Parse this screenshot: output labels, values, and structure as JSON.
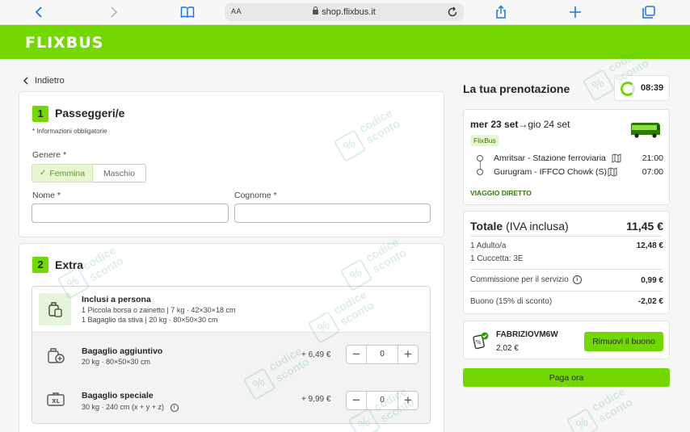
{
  "browser": {
    "aa_label": "AA",
    "url": "shop.flixbus.it"
  },
  "brand": {
    "logo": "FLIXBUS",
    "accent": "#73d700"
  },
  "nav": {
    "back_label": "Indietro"
  },
  "passengers": {
    "step": "1",
    "title": "Passeggeri/e",
    "required_note": "* Informazioni obbligatorie",
    "gender_label": "Genere *",
    "gender_options": [
      "Femmina",
      "Maschio"
    ],
    "gender_selected": "Femmina",
    "first_name_label": "Nome *",
    "last_name_label": "Cognome *",
    "first_name_value": "",
    "last_name_value": ""
  },
  "extras": {
    "step": "2",
    "title": "Extra",
    "included": {
      "title": "Inclusi a persona",
      "line1": "1 Piccola borsa o zainetto | 7 kg · 42×30×18 cm",
      "line2": "1 Bagaglio da stiva | 20 kg · 80×50×30 cm"
    },
    "items": [
      {
        "title": "Bagaglio aggiuntivo",
        "desc": "20 kg · 80×50×30 cm",
        "price": "+ 6,49 €",
        "qty": "0",
        "icon": "luggage-plus-icon"
      },
      {
        "title": "Bagaglio speciale",
        "desc": "30 kg · 240 cm (x + y + z)",
        "price": "+ 9,99 €",
        "qty": "0",
        "icon": "xl-luggage-icon"
      }
    ]
  },
  "booking": {
    "title": "La tua prenotazione",
    "timer": "08:39",
    "date_bold": "mer 23 set",
    "date_rest": "→gio 24 set",
    "operator": "FlixBus",
    "stops": [
      {
        "name": "Amritsar - Stazione ferroviaria",
        "time": "21:00"
      },
      {
        "name": "Gurugram - IFFCO Chowk (S)",
        "time": "07:00"
      }
    ],
    "direct_label": "VIAGGIO DIRETTO"
  },
  "totals": {
    "total_label": "Totale",
    "vat_label": " (IVA inclusa)",
    "total_value": "11,45 €",
    "adult_label": "1 Adulto/a",
    "adult_value": "12,48 €",
    "berth_label": "1 Cuccetta: 3E",
    "fee_label": "Commissione per il servizio",
    "fee_value": "0,99 €",
    "voucher_label": "Buono (15% di sconto)",
    "voucher_value": "-2,02 €"
  },
  "voucher": {
    "code": "FABRIZIOVM6W",
    "amount": "2,02 €",
    "remove_label": "Rimuovi il buono"
  },
  "pay": {
    "label": "Paga ora"
  },
  "watermark": {
    "line1": "codice",
    "line2": "sconto",
    "mark": "%"
  }
}
